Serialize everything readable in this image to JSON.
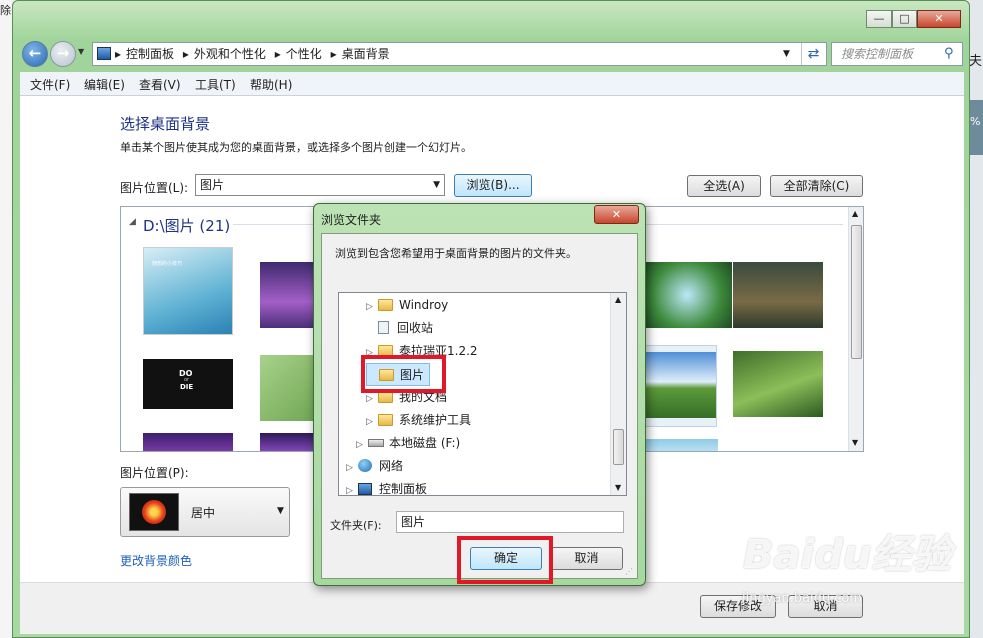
{
  "left_edge_text": "除",
  "right_edge_texts": [
    "夫",
    "%"
  ],
  "window_controls": {
    "minimize": "—",
    "maximize": "□",
    "close": "✕"
  },
  "address": {
    "breadcrumbs": [
      "控制面板",
      "外观和个性化",
      "个性化",
      "桌面背景"
    ],
    "search_placeholder": "搜索控制面板"
  },
  "menu": [
    "文件(F)",
    "编辑(E)",
    "查看(V)",
    "工具(T)",
    "帮助(H)"
  ],
  "page": {
    "title": "选择桌面背景",
    "subtitle": "单击某个图片使其成为您的桌面背景，或选择多个图片创建一个幻灯片。",
    "location_label": "图片位置(L):",
    "location_value": "图片",
    "browse_button": "浏览(B)...",
    "select_all_button": "全选(A)",
    "clear_all_button": "全部清除(C)",
    "group_header": "D:\\图片 (21)",
    "thumb1_text": "随想的小技巧",
    "thumb2_text1": "DO",
    "thumb2_text2": "or",
    "thumb2_text3": "DIE",
    "position_label": "图片位置(P):",
    "position_value": "居中",
    "change_color_link": "更改背景颜色",
    "save_button": "保存修改",
    "cancel_button": "取消"
  },
  "dialog": {
    "title": "浏览文件夹",
    "close_label": "✕",
    "instruction": "浏览到包含您希望用于桌面背景的图片的文件夹。",
    "tree": [
      {
        "label": "Windroy",
        "arrow": "▷"
      },
      {
        "label": "回收站",
        "arrow": ""
      },
      {
        "label": "泰拉瑞亚1.2.2",
        "arrow": "▷"
      },
      {
        "label": "图片",
        "arrow": ""
      },
      {
        "label": "我的文档",
        "arrow": "▷"
      },
      {
        "label": "系统维护工具",
        "arrow": "▷"
      },
      {
        "label": "本地磁盘 (F:)",
        "arrow": "▷"
      },
      {
        "label": "网络",
        "arrow": "▷"
      },
      {
        "label": "控制面板",
        "arrow": "▷"
      }
    ],
    "folder_label": "文件夹(F):",
    "folder_value": "图片",
    "ok_button": "确定",
    "cancel_button": "取消"
  },
  "watermark": {
    "logo": "Baidu经验",
    "url": "jingyan.baidu.com"
  },
  "colors": {
    "title_blue": "#1e3287",
    "highlight_red": "#e0182a",
    "selected_item": "#cce8ff"
  }
}
